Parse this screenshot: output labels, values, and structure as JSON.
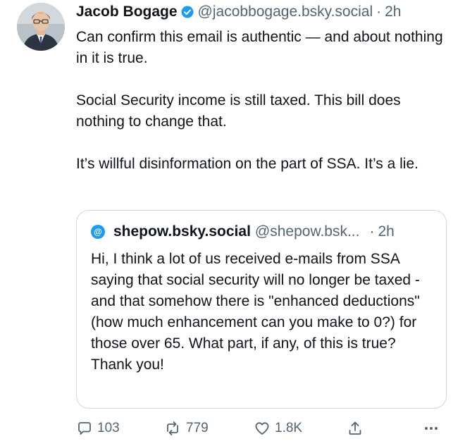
{
  "post": {
    "author_name": "Jacob Bogage",
    "handle": "@jacobbogage.bsky.social",
    "separator": "·",
    "time": "2h",
    "paragraphs": [
      "Can confirm this email is authentic — and about nothing in it is true.",
      "Social Security income is still taxed. This bill does nothing to change that.",
      "It’s willful disinformation on the part of SSA. It’s a lie."
    ],
    "icons": {
      "avatar": "avatar-photo",
      "verified": "verified-badge-icon"
    },
    "colors": {
      "verified": "#1d9bf0",
      "muted": "#536471",
      "text": "#0f1419",
      "border": "#cfd9de"
    }
  },
  "quote": {
    "avatar_glyph": "@",
    "author_name": "shepow.bsky.social",
    "handle": "@shepow.bsk...",
    "separator": "·",
    "time": "2h",
    "text": "Hi, I think a lot of us received e-mails from SSA saying that social security will no longer be taxed - and that somehow there is \"enhanced deductions\" (how much enhancement can you make to 0?) for those over 65.  What part, if any, of this is true? Thank you!"
  },
  "actions": {
    "reply_count": "103",
    "repost_count": "779",
    "like_count": "1.8K",
    "icons": [
      "reply-icon",
      "repost-icon",
      "like-icon",
      "share-icon",
      "more-icon"
    ]
  }
}
